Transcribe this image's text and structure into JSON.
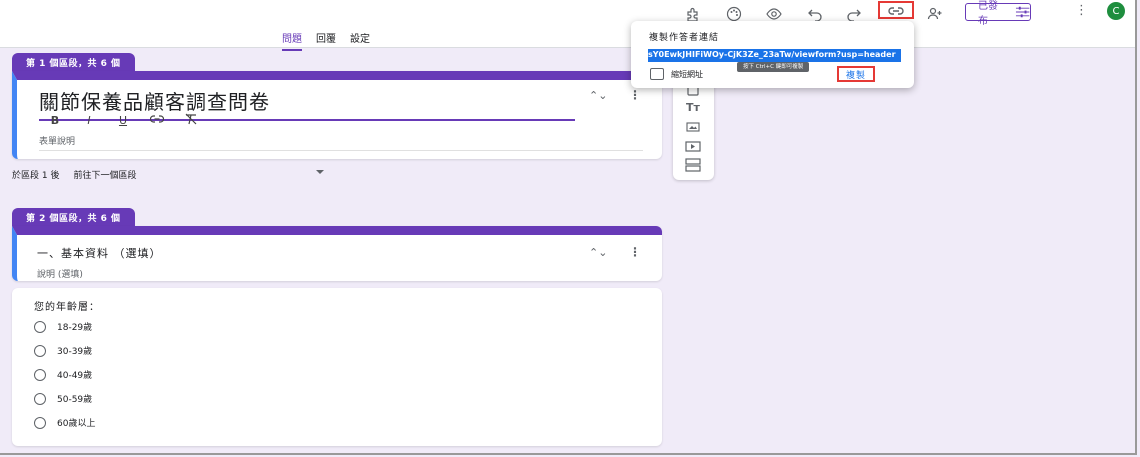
{
  "header": {
    "tabs": [
      {
        "label": "問題",
        "active": true
      },
      {
        "label": "回覆",
        "active": false
      },
      {
        "label": "設定",
        "active": false
      }
    ],
    "publish_label": "已發布",
    "avatar_initial": "C",
    "icons": [
      "addon-puzzle-icon",
      "palette-icon",
      "preview-eye-icon",
      "undo-icon",
      "redo-icon",
      "link-icon",
      "add-collaborator-icon",
      "publish-settings-icon",
      "more-vert-icon"
    ]
  },
  "section1": {
    "tab_label": "第 1 個區段，共 6 個",
    "title": "關節保養品顧客調查問卷",
    "format": {
      "bold": "B",
      "italic": "I",
      "underline": "U"
    },
    "description_placeholder": "表單說明"
  },
  "after_section": {
    "label": "於區段 1 後",
    "value": "前往下一個區段"
  },
  "section2": {
    "tab_label": "第 2 個區段，共 6 個",
    "title": "一、基本資料 （選填）",
    "description_placeholder": "說明 (選填)"
  },
  "question": {
    "text": "您的年齡層：",
    "options": [
      "18-29歲",
      "30-39歲",
      "40-49歲",
      "50-59歲",
      "60歲以上"
    ]
  },
  "side_toolbar": {
    "icons": [
      "add-question-icon",
      "title-text-icon",
      "image-icon",
      "video-icon",
      "section-icon"
    ],
    "title_glyph": "Tт"
  },
  "copy_link_popup": {
    "title": "複製作答者連結",
    "url": "sY0EwkJHIFiWOy-CjK3Ze_23aTw/viewform?usp=header",
    "tooltip": "按下 Ctrl+C 鍵即可複製",
    "shorten_label": "縮短網址",
    "copy_label": "複製"
  },
  "colors": {
    "accent": "#673ab7",
    "background": "#f0ebf8",
    "selected_border": "#4285f4",
    "highlight": "#e53935",
    "url_selection": "#1a73e8"
  }
}
